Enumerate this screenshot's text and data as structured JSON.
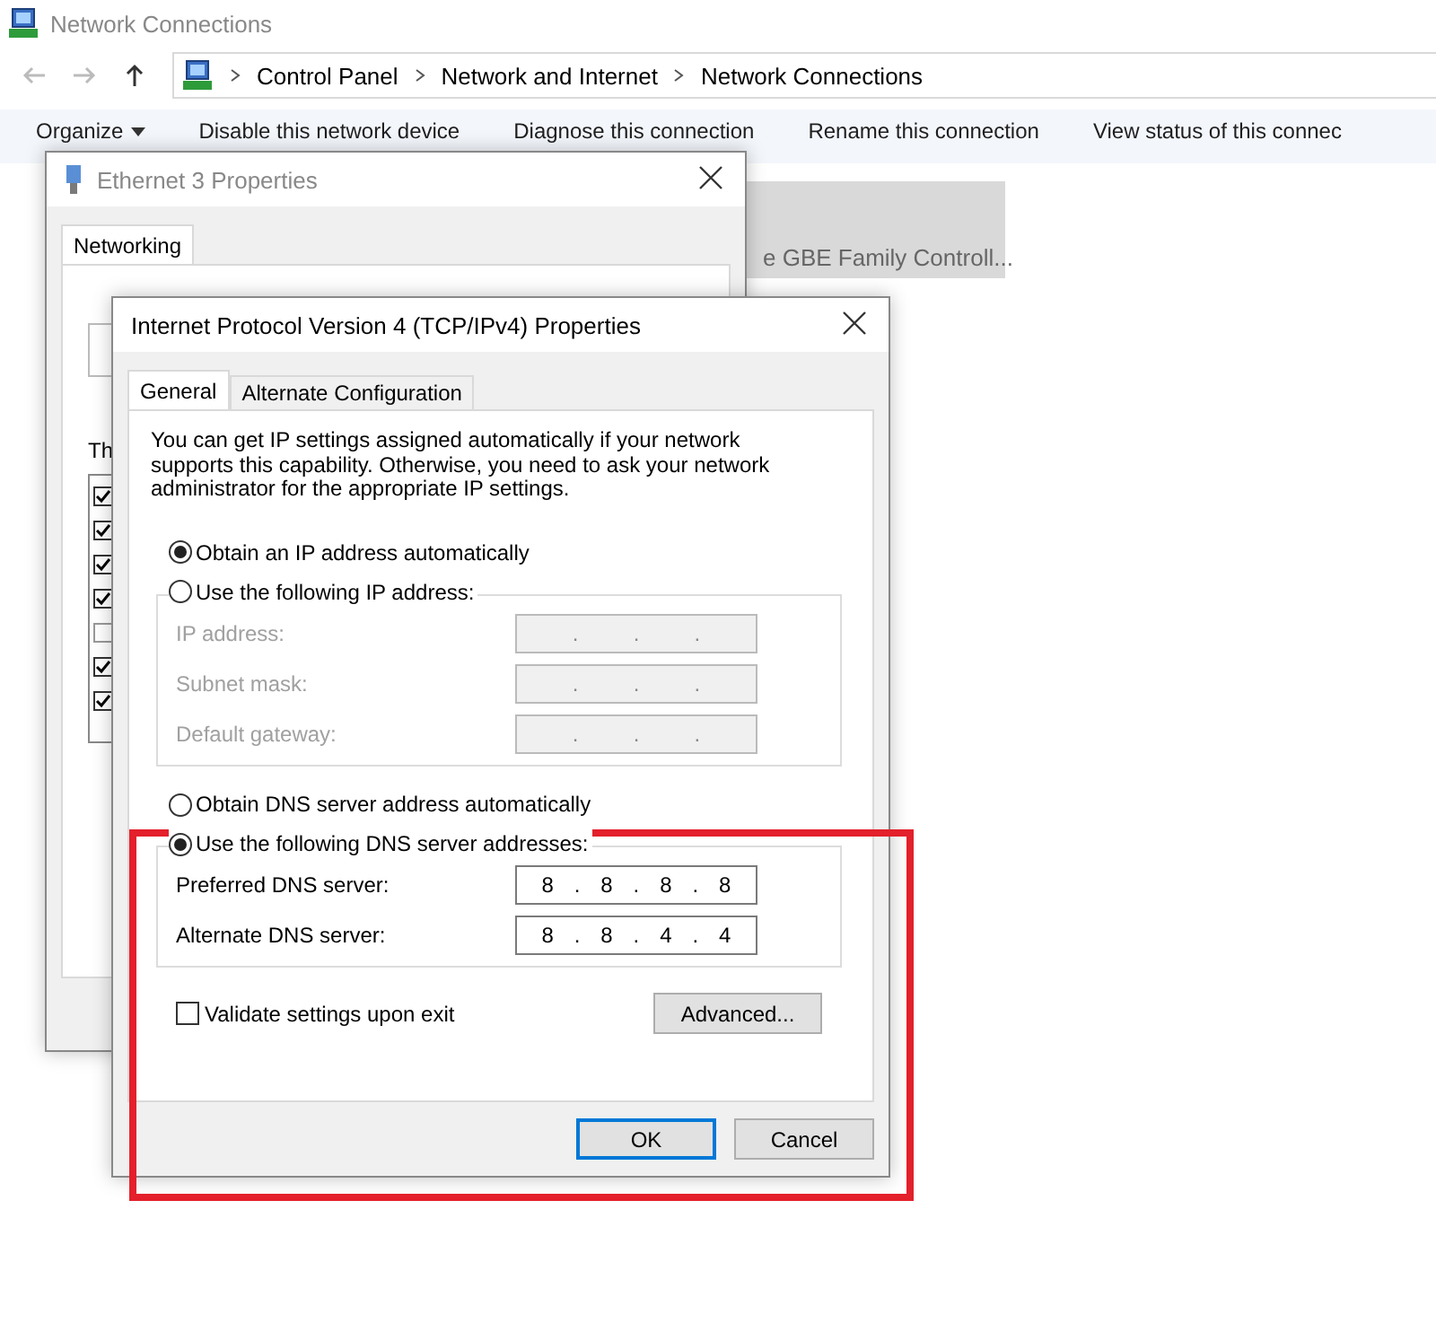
{
  "explorer": {
    "title": "Network Connections",
    "breadcrumbs": [
      "Control Panel",
      "Network and Internet",
      "Network Connections"
    ],
    "commands": [
      {
        "label": "Organize",
        "kind": "menu"
      },
      {
        "label": "Disable this network device",
        "kind": "action"
      },
      {
        "label": "Diagnose this connection",
        "kind": "action"
      },
      {
        "label": "Rename this connection",
        "kind": "action"
      },
      {
        "label": "View status of this connec",
        "kind": "action"
      }
    ],
    "adapter_label": "e GBE Family Controll..."
  },
  "ethernet_dialog": {
    "title": "Ethernet 3 Properties",
    "tabs": [
      {
        "label": "Networking",
        "selected": true
      }
    ],
    "list_caption": "Th",
    "components": [
      {
        "checked": true
      },
      {
        "checked": true
      },
      {
        "checked": true
      },
      {
        "checked": true
      },
      {
        "checked": false
      },
      {
        "checked": true
      },
      {
        "checked": true
      }
    ]
  },
  "ipv4_dialog": {
    "title": "Internet Protocol Version 4 (TCP/IPv4) Properties",
    "tabs": [
      {
        "label": "General",
        "selected": true
      },
      {
        "label": "Alternate Configuration",
        "selected": false
      }
    ],
    "description": "You can get IP settings assigned automatically if your network supports this capability. Otherwise, you need to ask your network administrator for the appropriate IP settings.",
    "octet_separator": ".",
    "ip_options": [
      {
        "label": "Obtain an IP address automatically",
        "selected": true
      },
      {
        "label": "Use the following IP address:",
        "selected": false
      }
    ],
    "ip_fields": [
      {
        "label": "IP address:",
        "disabled": true
      },
      {
        "label": "Subnet mask:",
        "disabled": true
      },
      {
        "label": "Default gateway:",
        "disabled": true
      }
    ],
    "dns_options": [
      {
        "label": "Obtain DNS server address automatically",
        "selected": false
      },
      {
        "label": "Use the following DNS server addresses:",
        "selected": true
      }
    ],
    "dns_fields": [
      {
        "label": "Preferred DNS server:",
        "disabled": false,
        "octets": [
          "8",
          "8",
          "8",
          "8"
        ]
      },
      {
        "label": "Alternate DNS server:",
        "disabled": false,
        "octets": [
          "8",
          "8",
          "4",
          "4"
        ]
      }
    ],
    "validate": {
      "label": "Validate settings upon exit",
      "checked": false
    },
    "advanced_button": "Advanced...",
    "buttons": [
      {
        "label": "OK",
        "default": true
      },
      {
        "label": "Cancel",
        "default": false
      }
    ]
  },
  "annotation": {
    "kind": "highlight",
    "color": "#e3202b"
  }
}
